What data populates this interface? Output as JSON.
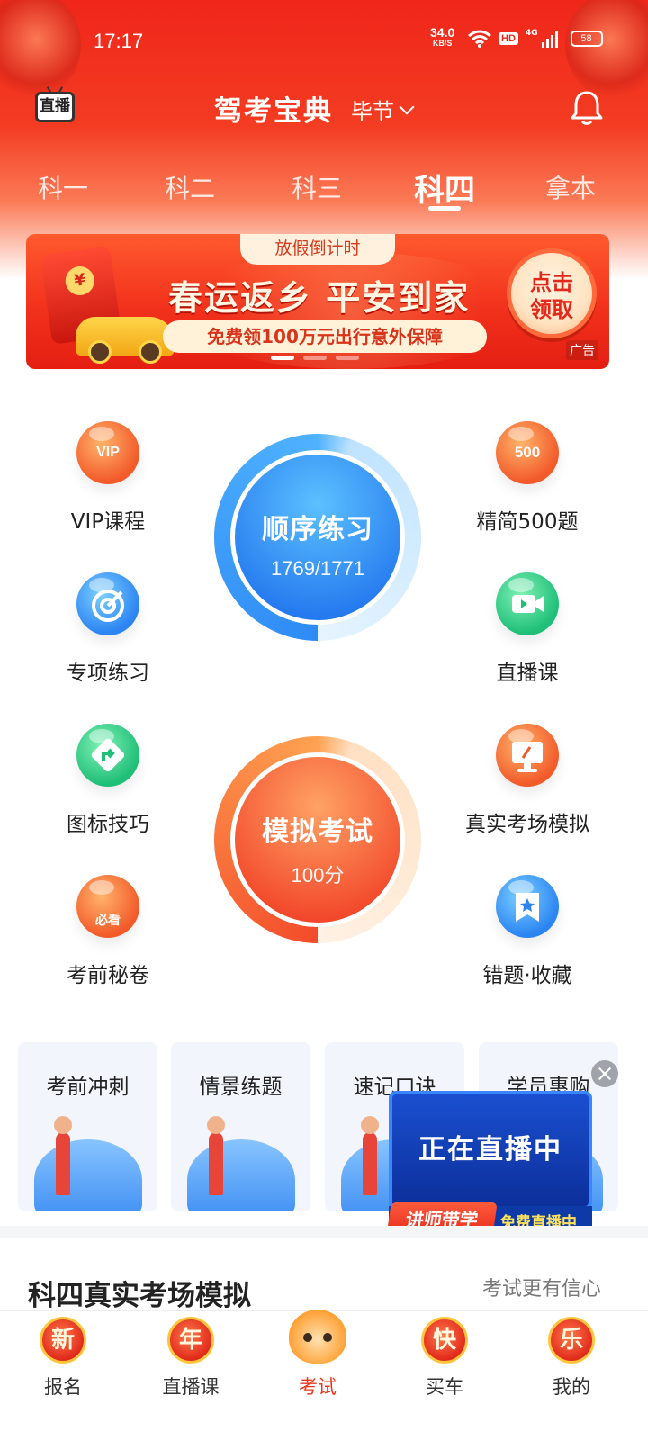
{
  "status_bar": {
    "time": "17:17",
    "net_speed": "34.0",
    "net_unit": "KB/S",
    "hd": "HD",
    "network": "4G",
    "battery": "58"
  },
  "header": {
    "live_label": "直播",
    "app_title": "驾考宝典",
    "city": "毕节"
  },
  "subject_tabs": [
    {
      "label": "科一"
    },
    {
      "label": "科二"
    },
    {
      "label": "科三"
    },
    {
      "label": "科四",
      "active": true
    },
    {
      "label": "拿本"
    }
  ],
  "banner": {
    "countdown": "放假倒计时",
    "headline": "春运返乡 平安到家",
    "subline": "免费领100万元出行意外保障",
    "claim": "点击领取",
    "ad": "广告",
    "coin_symbol": "¥"
  },
  "features": {
    "vip": "VIP课程",
    "vip_badge": "VIP",
    "special": "专项练习",
    "signs": "图标技巧",
    "secret": "考前秘卷",
    "secret_badge": "必看",
    "five_hundred": "精简500题",
    "five_hundred_badge": "500",
    "live_class": "直播课",
    "real_exam": "真实考场模拟",
    "mistakes": "错题·收藏"
  },
  "practice": {
    "title": "顺序练习",
    "progress": "1769/1771"
  },
  "mock_exam": {
    "title": "模拟考试",
    "score": "100分"
  },
  "cards": [
    {
      "title": "考前冲刺"
    },
    {
      "title": "情景练题"
    },
    {
      "title": "速记口诀"
    },
    {
      "title": "学员惠购"
    }
  ],
  "live_popup": {
    "text": "正在直播中",
    "tag": "讲师带学",
    "tag2": "免费直播中"
  },
  "section": {
    "title": "科四真实考场模拟",
    "subtitle": "考试更有信心"
  },
  "bottom_nav": [
    {
      "icon_char": "新",
      "label": "报名"
    },
    {
      "icon_char": "年",
      "label": "直播课"
    },
    {
      "icon_char": "",
      "label": "考试",
      "active": true
    },
    {
      "icon_char": "快",
      "label": "买车"
    },
    {
      "icon_char": "乐",
      "label": "我的"
    }
  ],
  "colors": {
    "primary_red": "#f0261a",
    "accent_blue": "#2b84f2",
    "accent_orange": "#f25a2a",
    "active_nav": "#e8381d"
  }
}
